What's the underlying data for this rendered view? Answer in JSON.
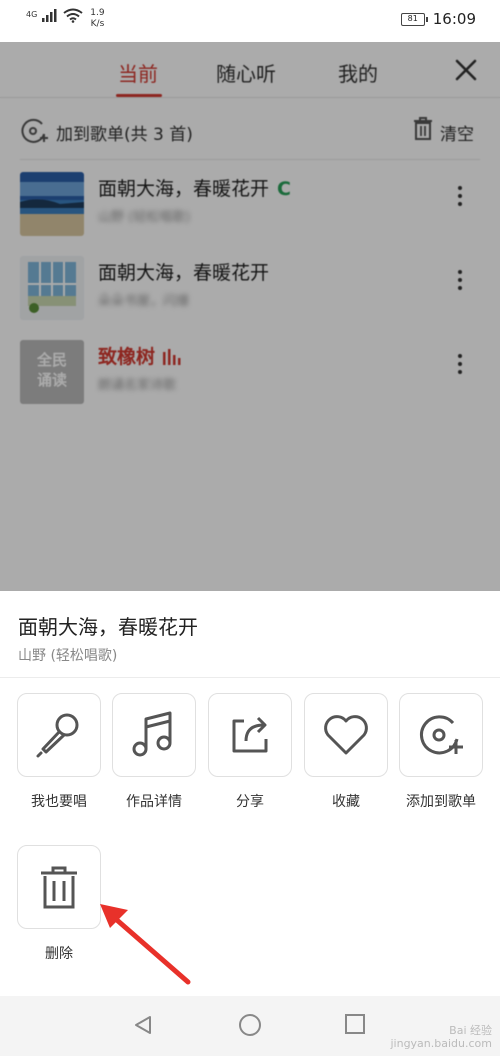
{
  "status_bar": {
    "network": "4G",
    "speed_value": "1.9",
    "speed_unit": "K/s",
    "battery": "81",
    "time": "16:09"
  },
  "playlist": {
    "tabs": [
      "当前",
      "随心听",
      "我的"
    ],
    "active_tab": "当前",
    "add_to_playlist": "加到歌单",
    "count_label": "(共 3 首)",
    "clear_label": "清空",
    "songs": [
      {
        "title": "面朝大海，春暖花开",
        "subtitle": "山野 (轻松唱歌)",
        "badge": "C",
        "playing": false
      },
      {
        "title": "面朝大海，春暖花开",
        "subtitle": "朵朵书屋，闪爆",
        "badge": "",
        "playing": false
      },
      {
        "title": "致橡树",
        "subtitle": "朗诵名家诗歌",
        "badge": "",
        "playing": true,
        "cover_text": "全民诵读"
      }
    ]
  },
  "sheet": {
    "title": "面朝大海，春暖花开",
    "subtitle": "山野 (轻松唱歌)",
    "actions": [
      {
        "label": "我也要唱",
        "icon": "microphone-icon"
      },
      {
        "label": "作品详情",
        "icon": "music-note-icon"
      },
      {
        "label": "分享",
        "icon": "share-icon"
      },
      {
        "label": "收藏",
        "icon": "heart-icon"
      },
      {
        "label": "添加到歌单",
        "icon": "add-to-playlist-icon"
      },
      {
        "label": "删除",
        "icon": "trash-icon"
      }
    ]
  },
  "colors": {
    "accent": "#d33a31",
    "badge_green": "#2aa05a",
    "annotation_arrow": "#e8312a"
  },
  "watermark": {
    "line1": "Bai 经验",
    "line2": "jingyan.baidu.com"
  }
}
